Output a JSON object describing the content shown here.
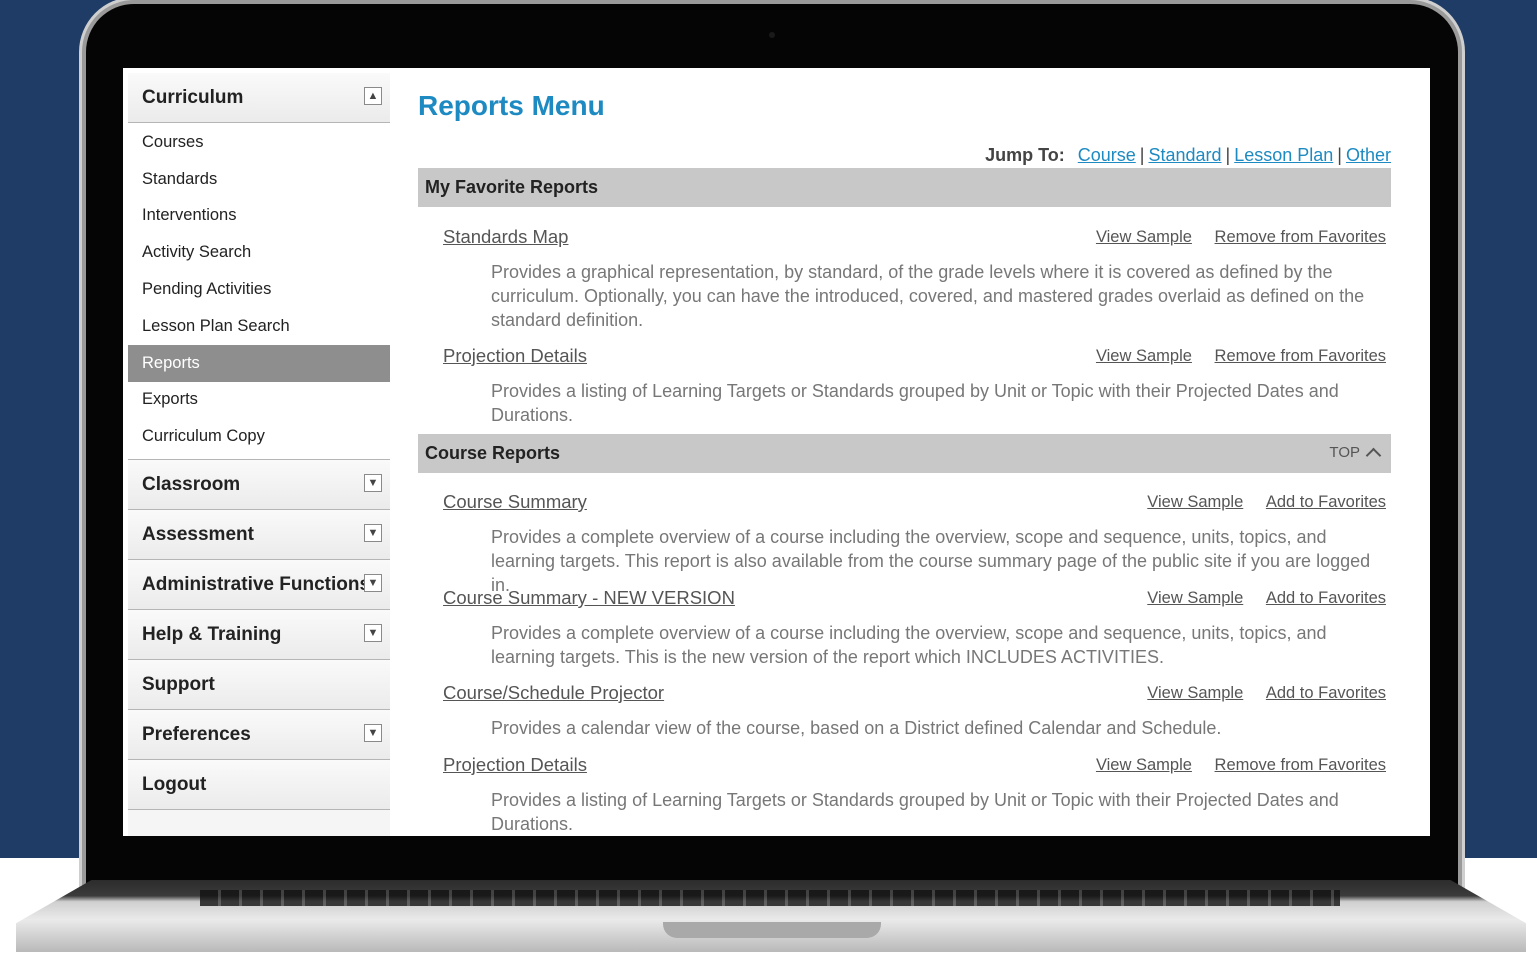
{
  "sidebar": {
    "curriculum": {
      "title": "Curriculum",
      "items": [
        "Courses",
        "Standards",
        "Interventions",
        "Activity Search",
        "Pending Activities",
        "Lesson Plan Search",
        "Reports",
        "Exports",
        "Curriculum Copy"
      ],
      "active": "Reports"
    },
    "sections": [
      "Classroom",
      "Assessment",
      "Administrative Functions",
      "Help & Training",
      "Support",
      "Preferences",
      "Logout"
    ]
  },
  "main": {
    "title": "Reports Menu",
    "jump": {
      "label": "Jump To:",
      "links": [
        "Course",
        "Standard",
        "Lesson Plan",
        "Other"
      ]
    },
    "favorites": {
      "title": "My Favorite Reports",
      "reports": [
        {
          "title": "Standards Map",
          "sample": "View Sample",
          "fav": "Remove from Favorites",
          "desc": "Provides a graphical representation, by standard, of the grade levels where it is covered as defined by the curriculum. Optionally, you can have the introduced, covered, and mastered grades overlaid as defined on the standard definition."
        },
        {
          "title": "Projection Details",
          "sample": "View Sample",
          "fav": "Remove from Favorites",
          "desc": "Provides a listing of Learning Targets or Standards grouped by Unit or Topic with their Projected Dates and Durations."
        }
      ]
    },
    "course": {
      "title": "Course Reports",
      "top": "TOP",
      "reports": [
        {
          "title": "Course Summary",
          "sample": "View Sample",
          "fav": "Add to Favorites",
          "desc": "Provides a complete overview of a course including the overview, scope and sequence, units, topics, and learning targets. This report is also available from the course summary page of the public site if you are logged in."
        },
        {
          "title": "Course Summary - NEW VERSION",
          "sample": "View Sample",
          "fav": "Add to Favorites",
          "desc": "Provides a complete overview of a course including the overview, scope and sequence, units, topics, and learning targets. This is the new version of the report which INCLUDES ACTIVITIES."
        },
        {
          "title": "Course/Schedule Projector",
          "sample": "View Sample",
          "fav": "Add to Favorites",
          "desc": "Provides a calendar view of the course, based on a District defined Calendar and Schedule."
        },
        {
          "title": "Projection Details",
          "sample": "View Sample",
          "fav": "Remove from Favorites",
          "desc": "Provides a listing of Learning Targets or Standards grouped by Unit or Topic with their Projected Dates and Durations."
        }
      ]
    }
  }
}
